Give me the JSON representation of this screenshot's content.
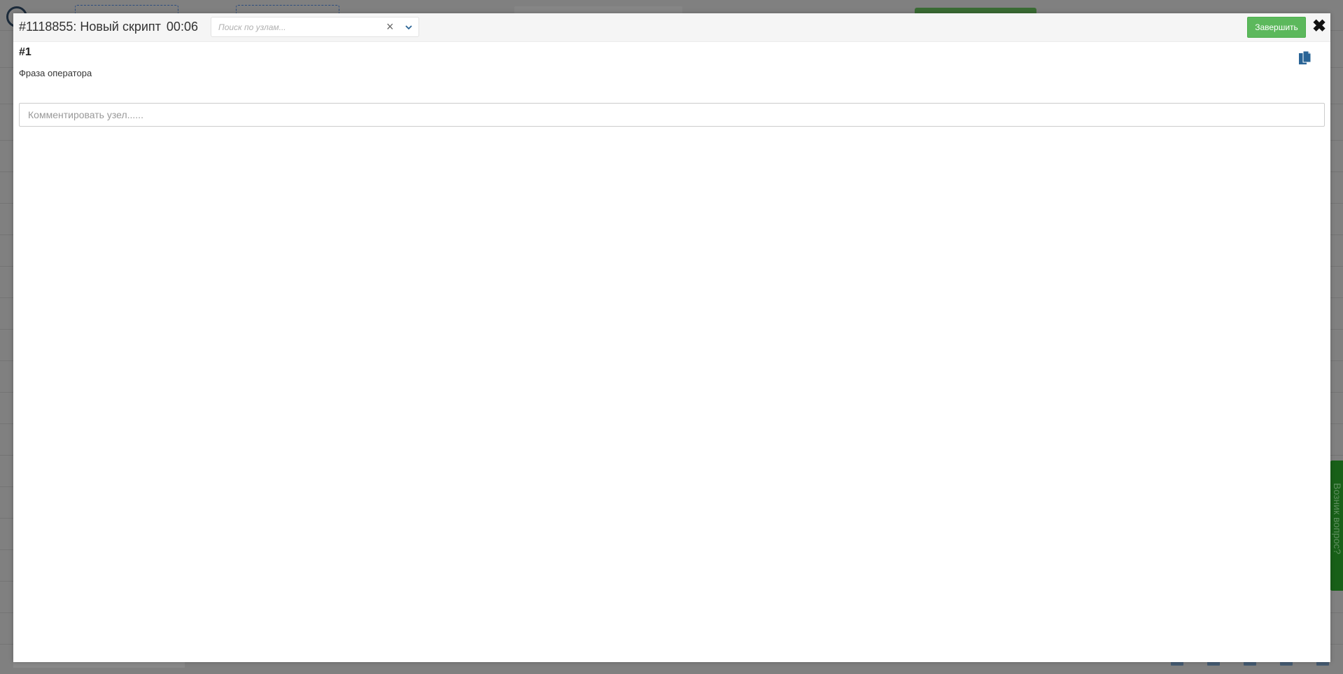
{
  "modal": {
    "title": "#1118855: Новый скрипт",
    "timer": "00:06",
    "search": {
      "placeholder": "Поиск по узлам...",
      "value": ""
    },
    "finish_label": "Завершить",
    "node": {
      "number": "#1",
      "text": "Фраза оператора"
    },
    "comment": {
      "placeholder": "Комментировать узел......",
      "value": ""
    }
  },
  "background": {
    "side_tab_label": "Возник вопрос?"
  },
  "colors": {
    "finish_button": "#5cb85c",
    "copy_icon": "#2a6496",
    "search_caret": "#2a6496",
    "overlay": "#808080"
  },
  "icons": {
    "clear": "times-icon",
    "caret": "chevron-down-icon",
    "close": "close-icon",
    "copy": "copy-icon"
  }
}
